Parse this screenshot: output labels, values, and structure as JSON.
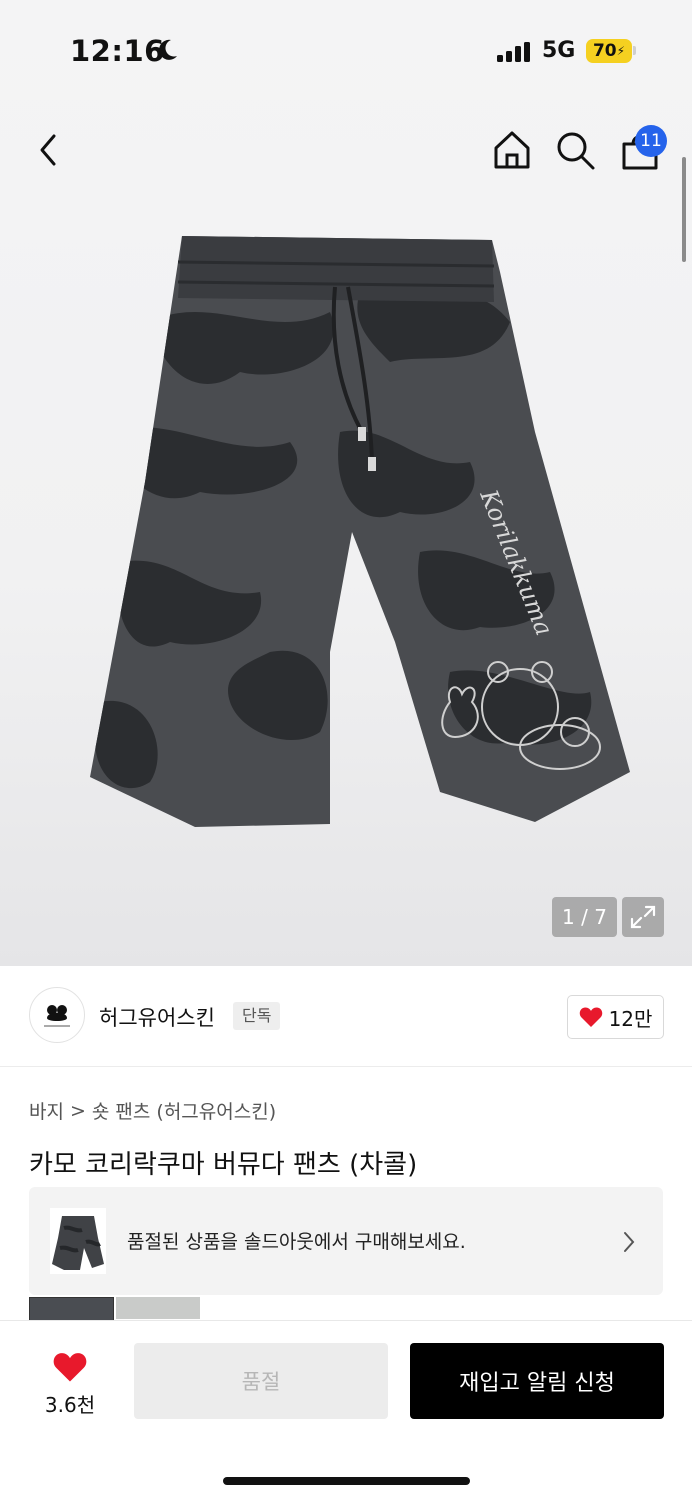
{
  "status_bar": {
    "time": "12:16",
    "network": "5G",
    "battery": "70"
  },
  "nav": {
    "cart_count": "11"
  },
  "gallery": {
    "counter": "1 / 7",
    "print_text": "Korilakkuma"
  },
  "brand": {
    "name": "허그유어스킨",
    "tag": "단독",
    "likes": "12만"
  },
  "breadcrumb": {
    "level1": "바지",
    "separator": ">",
    "level2": "숏 팬츠 (허그유어스킨)"
  },
  "product": {
    "title": "카모 코리락쿠마 버뮤다 팬츠 (차콜)"
  },
  "soldout_banner": {
    "text": "품절된 상품을 솔드아웃에서 구매해보세요."
  },
  "bottom_bar": {
    "wish_count": "3.6천",
    "soldout_label": "품절",
    "restock_label": "재입고 알림 신청"
  },
  "colors": {
    "accent_red": "#e8192c",
    "badge_blue": "#2563eb",
    "battery_yellow": "#f5d020"
  }
}
